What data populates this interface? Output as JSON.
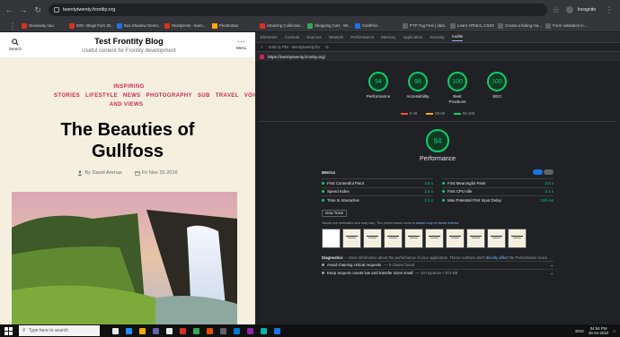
{
  "browser": {
    "url": "twentytwenty.frontity.org",
    "profile_label": "Incognito",
    "bookmarks": [
      {
        "label": "Giveaway sau:",
        "color": "#d93025"
      },
      {
        "label": "500+ Blogs from 30...",
        "color": "#d93025"
      },
      {
        "label": "Box Shadow Gener...",
        "color": "#1a73e8"
      },
      {
        "label": "Wordpress - learn...",
        "color": "#d93025"
      },
      {
        "label": "PlusExtras",
        "color": "#f9ab00"
      },
      {
        "label": "Amazing Collection...",
        "color": "#d93025"
      },
      {
        "label": "Shopping Cart - Wr...",
        "color": "#34a853"
      },
      {
        "label": "Cashfree",
        "color": "#1a73e8"
      },
      {
        "label": "PTP Tug Fest | dafa...",
        "color": "#5f6368"
      },
      {
        "label": "Learn HTML5, CSS3,...",
        "color": "#5f6368"
      },
      {
        "label": "Create a fading ma...",
        "color": "#5f6368"
      },
      {
        "label": "Form validation in...",
        "color": "#5f6368"
      }
    ]
  },
  "site": {
    "search_label": "Search",
    "menu_label": "Menu",
    "title": "Test Frontity Blog",
    "description": "Useful content for Frontity development",
    "categories": [
      "INSPIRING STORIES",
      "LIFESTYLE",
      "NEWS",
      "PHOTOGRAPHY",
      "SUB",
      "TRAVEL",
      "VOICES AND VIEWS"
    ],
    "post_title": "The Beauties of Gullfoss",
    "author": "By David Arenas",
    "date": "Fri Nov 25 2016"
  },
  "devtools": {
    "tabs": [
      "Elements",
      "Console",
      "Sources",
      "Network",
      "Performance",
      "Memory",
      "Application",
      "Security",
      "Audits"
    ],
    "active_tab": "Audits",
    "run_label": "4:56:11 PM - twentytwenty.fro",
    "audited_url": "https://twentytwenty.frontity.org/",
    "scores": [
      {
        "value": "94",
        "label": "Performance"
      },
      {
        "value": "98",
        "label": "Accessibility"
      },
      {
        "value": "100",
        "label": "Best Practices"
      },
      {
        "value": "100",
        "label": "SEO"
      }
    ],
    "legend": [
      {
        "range": "0-49",
        "color": "#ff4e42"
      },
      {
        "range": "50-89",
        "color": "#ffa400"
      },
      {
        "range": "90-100",
        "color": "#0cce6b"
      }
    ],
    "perf_score": "94",
    "perf_label": "Performance",
    "metrics_label": "Metrics",
    "metrics": [
      {
        "name": "First Contentful Paint",
        "value": "2.6 s"
      },
      {
        "name": "First Meaningful Paint",
        "value": "2.6 s"
      },
      {
        "name": "Speed Index",
        "value": "2.4 s"
      },
      {
        "name": "First CPU Idle",
        "value": "3.1 s"
      },
      {
        "name": "Time to Interactive",
        "value": "3.1 s"
      },
      {
        "name": "Max Potential First Input Delay",
        "value": "130 ms"
      }
    ],
    "view_trace": "View Trace",
    "note_text": "Values are estimated and may vary. The performance score is",
    "note_link": "based only on these metrics",
    "diagnostics_title": "Diagnostics",
    "diagnostics_text": "— More information about the performance of your application. These numbers don't",
    "diagnostics_link": "directly affect",
    "diagnostics_tail": "the Performance score.",
    "audits": [
      {
        "name": "Avoid chaining critical requests",
        "detail": "— 5 chains found"
      },
      {
        "name": "Keep request counts low and transfer sizes small",
        "detail": "— 10 requests • 373 KB"
      }
    ]
  },
  "taskbar": {
    "search_placeholder": "Type here to search",
    "language": "ENG",
    "time": "04:56 PM",
    "date": "25-04-2020"
  }
}
